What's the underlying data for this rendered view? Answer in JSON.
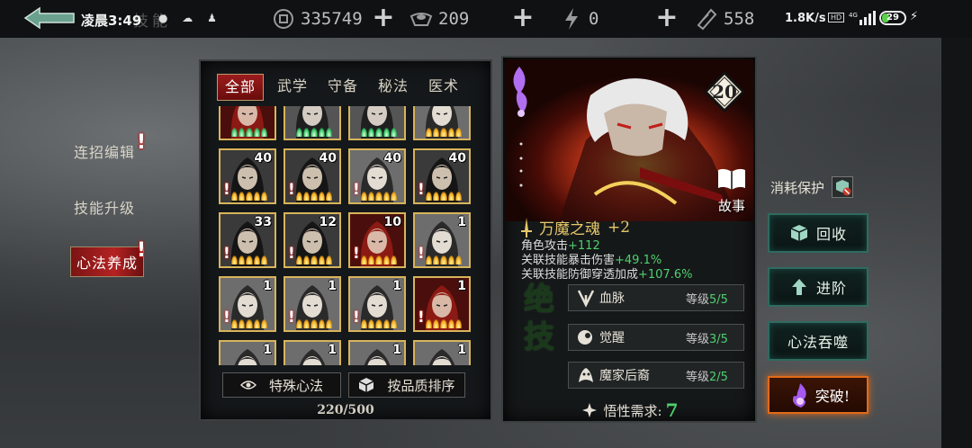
{
  "status_bar": {
    "time": "凌晨3:49",
    "page_title_faded": "技能",
    "net_speed": "1.8K/s",
    "hd_badge": "HD",
    "battery": "29"
  },
  "resources": [
    {
      "icon": "coin-icon",
      "value": "335749"
    },
    {
      "icon": "ingot-icon",
      "value": "209"
    },
    {
      "icon": "lightning-icon",
      "value": "0"
    },
    {
      "icon": "ticket-icon",
      "value": "558"
    }
  ],
  "sidebar": {
    "items": [
      {
        "label": "连招编辑",
        "alert": "!"
      },
      {
        "label": "技能升级",
        "alert": ""
      },
      {
        "label": "心法养成",
        "alert": "!"
      }
    ]
  },
  "grid_panel": {
    "tabs": [
      "全部",
      "武学",
      "守备",
      "秘法",
      "医术"
    ],
    "cards": [
      {
        "level": "",
        "alert": false,
        "flames": "green",
        "tone": "red"
      },
      {
        "level": "",
        "alert": false,
        "flames": "green",
        "tone": "grey"
      },
      {
        "level": "",
        "alert": false,
        "flames": "green",
        "tone": "grey"
      },
      {
        "level": "",
        "alert": false,
        "flames": "gold",
        "tone": "pale"
      },
      {
        "level": "40",
        "alert": true,
        "flames": "gold",
        "tone": "dark"
      },
      {
        "level": "40",
        "alert": true,
        "flames": "gold",
        "tone": "dark"
      },
      {
        "level": "40",
        "alert": true,
        "flames": "gold",
        "tone": "pale"
      },
      {
        "level": "40",
        "alert": true,
        "flames": "gold",
        "tone": "dark"
      },
      {
        "level": "33",
        "alert": true,
        "flames": "gold",
        "tone": "dark"
      },
      {
        "level": "12",
        "alert": true,
        "flames": "gold",
        "tone": "dark"
      },
      {
        "level": "10",
        "alert": true,
        "flames": "gold",
        "tone": "red"
      },
      {
        "level": "1",
        "alert": true,
        "flames": "gold",
        "tone": "pale"
      },
      {
        "level": "1",
        "alert": true,
        "flames": "gold",
        "tone": "pale"
      },
      {
        "level": "1",
        "alert": true,
        "flames": "gold",
        "tone": "pale"
      },
      {
        "level": "1",
        "alert": true,
        "flames": "gold",
        "tone": "pale"
      },
      {
        "level": "1",
        "alert": true,
        "flames": "gold",
        "tone": "red"
      },
      {
        "level": "1",
        "alert": true,
        "flames": "gold",
        "tone": "pale"
      },
      {
        "level": "1",
        "alert": true,
        "flames": "gold",
        "tone": "pale"
      },
      {
        "level": "1",
        "alert": true,
        "flames": "gold",
        "tone": "pale"
      },
      {
        "level": "1",
        "alert": true,
        "flames": "gold",
        "tone": "pale"
      }
    ],
    "buttons": {
      "special": "特殊心法",
      "sort": "按品质排序"
    },
    "count": "220/500"
  },
  "detail": {
    "level": "20",
    "story_label": "故事",
    "skill_name": "万魔之魂",
    "skill_plus": "+2",
    "stats": [
      {
        "label": "角色攻击",
        "value": "+112"
      },
      {
        "label": "关联技能暴击伤害",
        "value": "+49.1%"
      },
      {
        "label": "关联技能防御穿透加成",
        "value": "+107.6%"
      }
    ],
    "stamp": "绝技",
    "attributes": [
      {
        "icon": "bloodline-icon",
        "name": "血脉",
        "level_label": "等级",
        "level": "5/5"
      },
      {
        "icon": "awaken-icon",
        "name": "觉醒",
        "level_label": "等级",
        "level": "3/5"
      },
      {
        "icon": "demon-heir-icon",
        "name": "魔家后裔",
        "level_label": "等级",
        "level": "2/5"
      }
    ],
    "requirement_label": "悟性需求:",
    "requirement_value": "7"
  },
  "actions": {
    "protect_label": "消耗保护",
    "recycle": "回收",
    "advance": "进阶",
    "devour": "心法吞噬",
    "breakthrough": "突破!"
  },
  "colors": {
    "accent_red": "#9c1c1c",
    "stat_green": "#4fd06e",
    "gold": "#e8c76a",
    "teal_border": "#2f6a60",
    "orange_glow": "#e06a1a"
  }
}
